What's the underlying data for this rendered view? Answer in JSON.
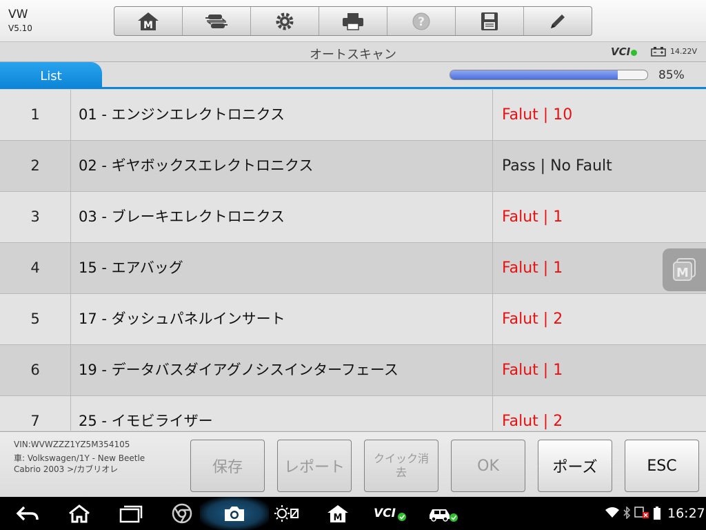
{
  "app": {
    "name": "VW",
    "version": "V5.10"
  },
  "toolbar": {
    "buttons": [
      "home-m-icon",
      "car-swap-icon",
      "gear-icon",
      "printer-icon",
      "help-icon",
      "save-disk-icon",
      "pencil-icon"
    ]
  },
  "header": {
    "title": "オートスキャン",
    "vci_label": "VCI",
    "voltage": "14.22V"
  },
  "tabs": [
    {
      "label": "List",
      "active": true
    }
  ],
  "progress": {
    "percent_label": "85%",
    "value": 0.85
  },
  "rows": [
    {
      "num": "1",
      "module": "01 - エンジンエレクトロニクス",
      "status": "Falut | 10",
      "fault": true
    },
    {
      "num": "2",
      "module": "02 - ギヤボックスエレクトロニクス",
      "status": "Pass | No Fault",
      "fault": false
    },
    {
      "num": "3",
      "module": "03 - ブレーキエレクトロニクス",
      "status": "Falut | 1",
      "fault": true
    },
    {
      "num": "4",
      "module": "15 - エアバッグ",
      "status": "Falut | 1",
      "fault": true
    },
    {
      "num": "5",
      "module": "17 - ダッシュパネルインサート",
      "status": "Falut | 2",
      "fault": true
    },
    {
      "num": "6",
      "module": "19 - データバスダイアグノシスインターフェース",
      "status": "Falut | 1",
      "fault": true
    },
    {
      "num": "7",
      "module": "25 - イモビライザー",
      "status": "Falut | 2",
      "fault": true
    }
  ],
  "vehicle": {
    "vin": "VIN:WVWZZZ1YZ5M354105",
    "car_line1": "車: Volkswagen/1Y - New Beetle",
    "car_line2": "Cabrio 2003 >/カブリオレ"
  },
  "actions": {
    "save": "保存",
    "report": "レポート",
    "quick_erase": "クイック消去",
    "ok": "OK",
    "pause": "ポーズ",
    "esc": "ESC"
  },
  "statusbar": {
    "time": "16:27"
  },
  "colors": {
    "accent": "#0d86d8",
    "fault": "#e81010",
    "progress": "#4c6ede"
  }
}
